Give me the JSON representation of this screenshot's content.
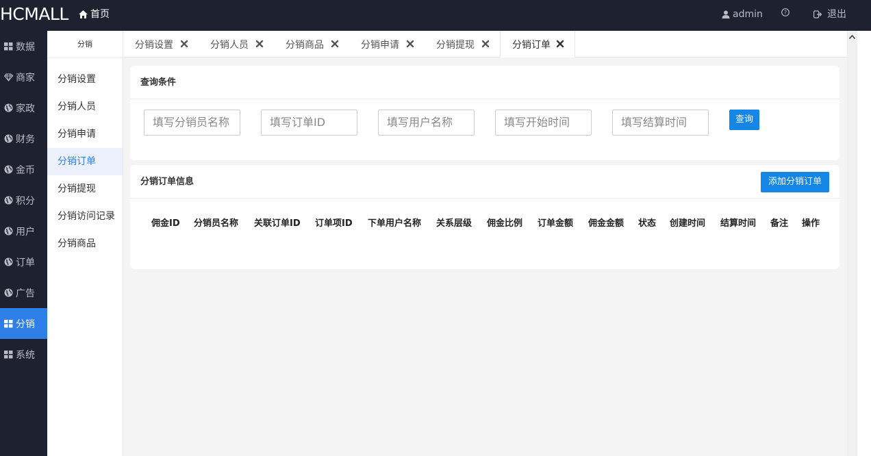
{
  "app": {
    "logo": "HCMALL",
    "home": "首页",
    "user": "admin",
    "logout": "退出"
  },
  "rail": {
    "items": [
      {
        "label": "数据",
        "icon": "grid-icon"
      },
      {
        "label": "商家",
        "icon": "diamond-icon"
      },
      {
        "label": "家政",
        "icon": "globe-icon"
      },
      {
        "label": "财务",
        "icon": "globe-icon"
      },
      {
        "label": "金币",
        "icon": "globe-icon"
      },
      {
        "label": "积分",
        "icon": "globe-icon"
      },
      {
        "label": "用户",
        "icon": "globe-icon"
      },
      {
        "label": "订单",
        "icon": "globe-icon"
      },
      {
        "label": "广告",
        "icon": "globe-icon"
      },
      {
        "label": "分销",
        "icon": "grid-icon",
        "active": true
      },
      {
        "label": "系统",
        "icon": "grid-icon"
      }
    ]
  },
  "submenu": {
    "title": "分销",
    "items": [
      {
        "label": "分销设置"
      },
      {
        "label": "分销人员"
      },
      {
        "label": "分销申请"
      },
      {
        "label": "分销订单",
        "active": true
      },
      {
        "label": "分销提现"
      },
      {
        "label": "分销访问记录"
      },
      {
        "label": "分销商品"
      }
    ]
  },
  "tabs": [
    {
      "label": "分销设置"
    },
    {
      "label": "分销人员"
    },
    {
      "label": "分销商品"
    },
    {
      "label": "分销申请"
    },
    {
      "label": "分销提现"
    },
    {
      "label": "分销订单",
      "active": true
    }
  ],
  "query": {
    "title": "查询条件",
    "placeholders": [
      "填写分销员名称",
      "填写订单ID",
      "填写用户名称",
      "填写开始时间",
      "填写结算时间"
    ],
    "search_button": "查询"
  },
  "orders": {
    "title": "分销订单信息",
    "add_button": "添加分销订单",
    "columns": [
      "佣金ID",
      "分销员名称",
      "关联订单ID",
      "订单项ID",
      "下单用户名称",
      "关系层级",
      "佣金比例",
      "订单金额",
      "佣金金额",
      "状态",
      "创建时间",
      "结算时间",
      "备注",
      "操作"
    ]
  },
  "colors": {
    "sidebar_bg": "#1e2130",
    "accent": "#2f7fe8",
    "button": "#1585e6"
  }
}
